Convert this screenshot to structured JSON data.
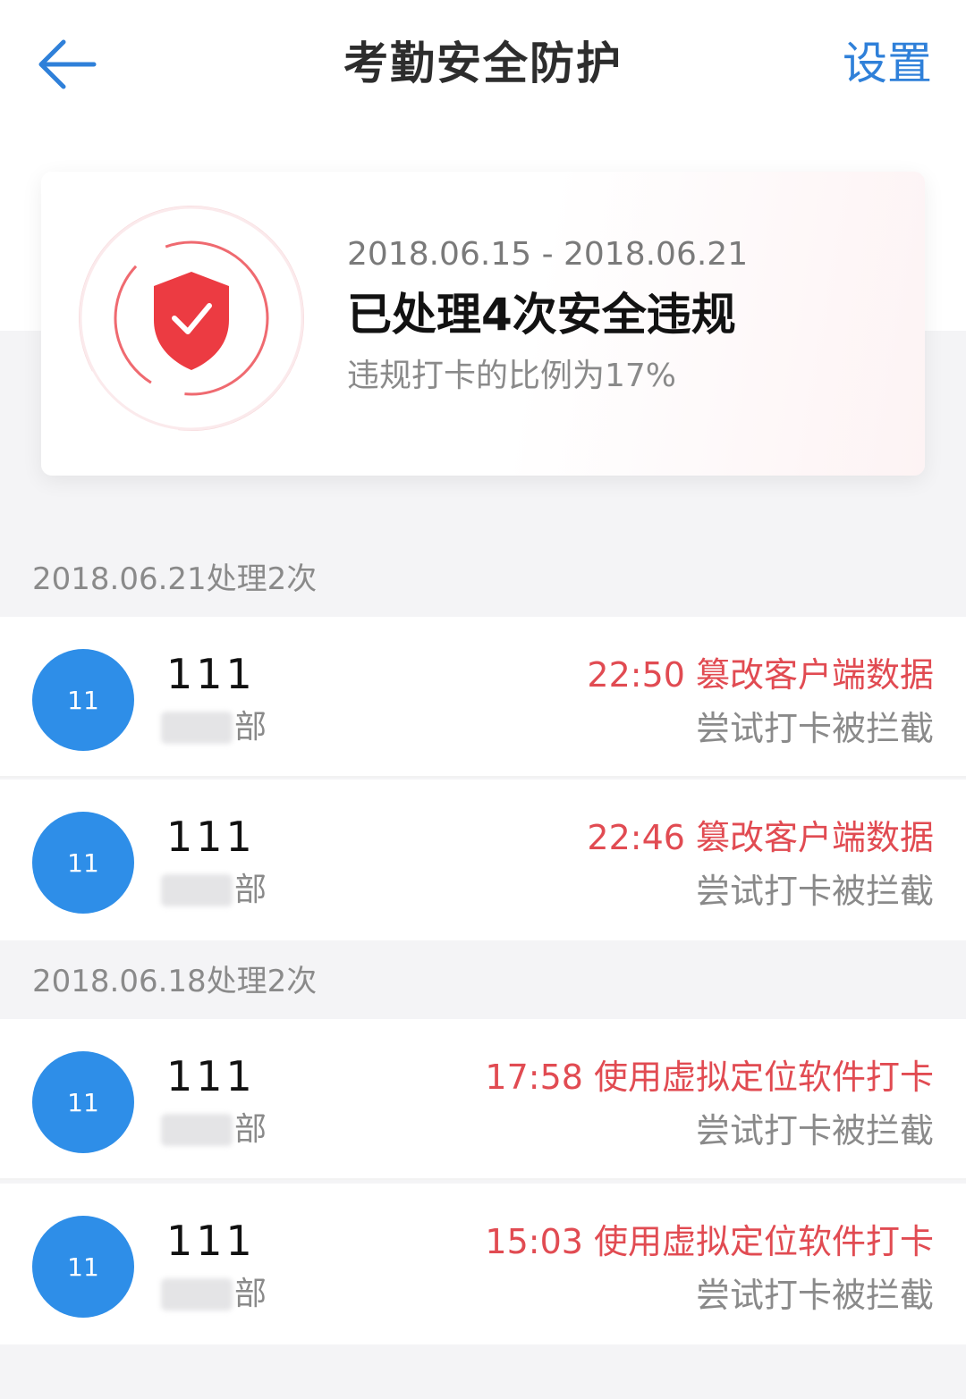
{
  "header": {
    "title": "考勤安全防护",
    "settings_label": "设置",
    "back_icon": "back-arrow-icon"
  },
  "summary": {
    "date_range": "2018.06.15 - 2018.06.21",
    "headline": "已处理4次安全违规",
    "ratio_text": "违规打卡的比例为17%",
    "icon": "shield-check-icon"
  },
  "groups": [
    {
      "header": "2018.06.21处理2次",
      "items": [
        {
          "avatar": "11",
          "name": "111",
          "dept_suffix": "部",
          "violation": "22:50 篡改客户端数据",
          "status": "尝试打卡被拦截"
        },
        {
          "avatar": "11",
          "name": "111",
          "dept_suffix": "部",
          "violation": "22:46 篡改客户端数据",
          "status": "尝试打卡被拦截"
        }
      ]
    },
    {
      "header": "2018.06.18处理2次",
      "items": [
        {
          "avatar": "11",
          "name": "111",
          "dept_suffix": "部",
          "violation": "17:58 使用虚拟定位软件打卡",
          "status": "尝试打卡被拦截"
        },
        {
          "avatar": "11",
          "name": "111",
          "dept_suffix": "部",
          "violation": "15:03 使用虚拟定位软件打卡",
          "status": "尝试打卡被拦截"
        }
      ]
    }
  ],
  "colors": {
    "accent": "#2f80d9",
    "avatar": "#2e8ee8",
    "danger": "#e14b52"
  }
}
